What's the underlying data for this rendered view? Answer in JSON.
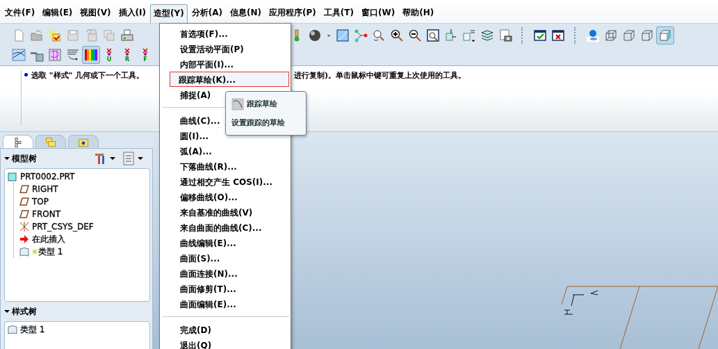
{
  "menubar": [
    {
      "label": "文件(F)",
      "selected": false
    },
    {
      "label": "编辑(E)",
      "selected": false
    },
    {
      "label": "视图(V)",
      "selected": false
    },
    {
      "label": "插入(I)",
      "selected": false
    },
    {
      "label": "造型(Y)",
      "selected": true
    },
    {
      "label": "分析(A)",
      "selected": false
    },
    {
      "label": "信息(N)",
      "selected": false
    },
    {
      "label": "应用程序(P)",
      "selected": false
    },
    {
      "label": "工具(T)",
      "selected": false
    },
    {
      "label": "窗口(W)",
      "selected": false
    },
    {
      "label": "帮助(H)",
      "selected": false
    }
  ],
  "toolbar_row1": [
    {
      "kind": "new",
      "selected": false
    },
    {
      "kind": "open",
      "selected": false
    },
    {
      "kind": "folder-check",
      "selected": false
    },
    {
      "kind": "save",
      "selected": false
    },
    {
      "kind": "save-copy",
      "selected": false
    },
    {
      "kind": "copy",
      "selected": false
    },
    {
      "kind": "print",
      "selected": false
    },
    {
      "kind": "gap"
    },
    {
      "kind": "light",
      "selected": false
    },
    {
      "kind": "sphere",
      "selected": false
    },
    {
      "kind": "caret",
      "selected": false
    },
    {
      "kind": "spray",
      "selected": false
    },
    {
      "kind": "nodes",
      "selected": false
    },
    {
      "kind": "orient",
      "selected": false
    },
    {
      "kind": "zoom-in",
      "selected": false
    },
    {
      "kind": "zoom-out",
      "selected": false
    },
    {
      "kind": "zoom-fit",
      "selected": false
    },
    {
      "kind": "cube-arrows",
      "selected": false
    },
    {
      "kind": "cube-ab",
      "selected": false
    },
    {
      "kind": "layers",
      "selected": false
    },
    {
      "kind": "camera",
      "selected": false
    },
    {
      "kind": "separator"
    },
    {
      "kind": "window-check",
      "selected": false
    },
    {
      "kind": "window-x",
      "selected": false
    },
    {
      "kind": "separator"
    },
    {
      "kind": "ball",
      "selected": false
    },
    {
      "kind": "wire",
      "selected": false
    },
    {
      "kind": "hidden",
      "selected": false
    },
    {
      "kind": "cube",
      "selected": false
    },
    {
      "kind": "shaded",
      "selected": true
    }
  ],
  "toolbar_row2": [
    {
      "kind": "graph",
      "selected": false
    },
    {
      "kind": "ruler",
      "selected": false
    },
    {
      "kind": "mesh",
      "selected": false
    },
    {
      "kind": "lines",
      "selected": false
    },
    {
      "kind": "rainbow",
      "selected": true
    },
    {
      "kind": "pin-u",
      "selected": false,
      "label": "U"
    },
    {
      "kind": "pin-r",
      "selected": false,
      "label": "R"
    },
    {
      "kind": "pin-f",
      "selected": false,
      "label": "F"
    }
  ],
  "message": {
    "left": "选取 \"样式\" 几何或下一个工具。",
    "right": "进行复制)。单击鼠标中键可重复上次使用的工具。"
  },
  "panel_tabs": [
    {
      "kind": "tree",
      "selected": true
    },
    {
      "kind": "folders",
      "selected": false
    },
    {
      "kind": "folder-star",
      "selected": false
    }
  ],
  "model_tree": {
    "title": "模型树",
    "expanded": true,
    "items": [
      {
        "label": "PRT0002.PRT",
        "kind": "part",
        "children": [
          {
            "label": "RIGHT",
            "kind": "plane"
          },
          {
            "label": "TOP",
            "kind": "plane"
          },
          {
            "label": "FRONT",
            "kind": "plane"
          },
          {
            "label": "PRT_CSYS_DEF",
            "kind": "csys"
          },
          {
            "label": "在此插入",
            "kind": "insert"
          },
          {
            "label": "类型 1",
            "kind": "style"
          }
        ]
      }
    ]
  },
  "style_tree": {
    "title": "样式树",
    "expanded": true,
    "items": [
      {
        "label": "类型 1",
        "kind": "style"
      }
    ]
  },
  "menu": [
    {
      "kind": "item",
      "label": "首选项(F)...",
      "selected": false
    },
    {
      "kind": "item",
      "label": "设置活动平面(P)",
      "selected": false
    },
    {
      "kind": "item",
      "label": "内部平面(I)...",
      "selected": false
    },
    {
      "kind": "item",
      "label": "跟踪草绘(K)...",
      "selected": true,
      "annotated": true
    },
    {
      "kind": "item",
      "label": "捕捉(A)",
      "selected": false
    },
    {
      "kind": "separator"
    },
    {
      "kind": "item",
      "label": "曲线(C)...",
      "selected": false
    },
    {
      "kind": "item",
      "label": "圆(I)...",
      "selected": false
    },
    {
      "kind": "item",
      "label": "弧(A)...",
      "selected": false
    },
    {
      "kind": "item",
      "label": "下落曲线(R)...",
      "selected": false
    },
    {
      "kind": "item",
      "label": "通过相交产生 COS(I)...",
      "selected": false
    },
    {
      "kind": "item",
      "label": "偏移曲线(O)...",
      "selected": false
    },
    {
      "kind": "item",
      "label": "来自基准的曲线(V)",
      "selected": false
    },
    {
      "kind": "item",
      "label": "来自曲面的曲线(C)...",
      "selected": false
    },
    {
      "kind": "item",
      "label": "曲线编辑(E)...",
      "selected": false
    },
    {
      "kind": "item",
      "label": "曲面(S)...",
      "selected": false
    },
    {
      "kind": "item",
      "label": "曲面连接(N)...",
      "selected": false
    },
    {
      "kind": "item",
      "label": "曲面修剪(T)...",
      "selected": false
    },
    {
      "kind": "item",
      "label": "曲面编辑(E)...",
      "selected": false
    },
    {
      "kind": "separator"
    },
    {
      "kind": "item",
      "label": "完成(D)",
      "selected": false
    },
    {
      "kind": "item",
      "label": "退出(Q)",
      "selected": false
    }
  ],
  "submenu": [
    {
      "label": "跟踪草绘",
      "kind": "icon"
    },
    {
      "label": "设置跟踪的草绘",
      "kind": "plain"
    }
  ]
}
